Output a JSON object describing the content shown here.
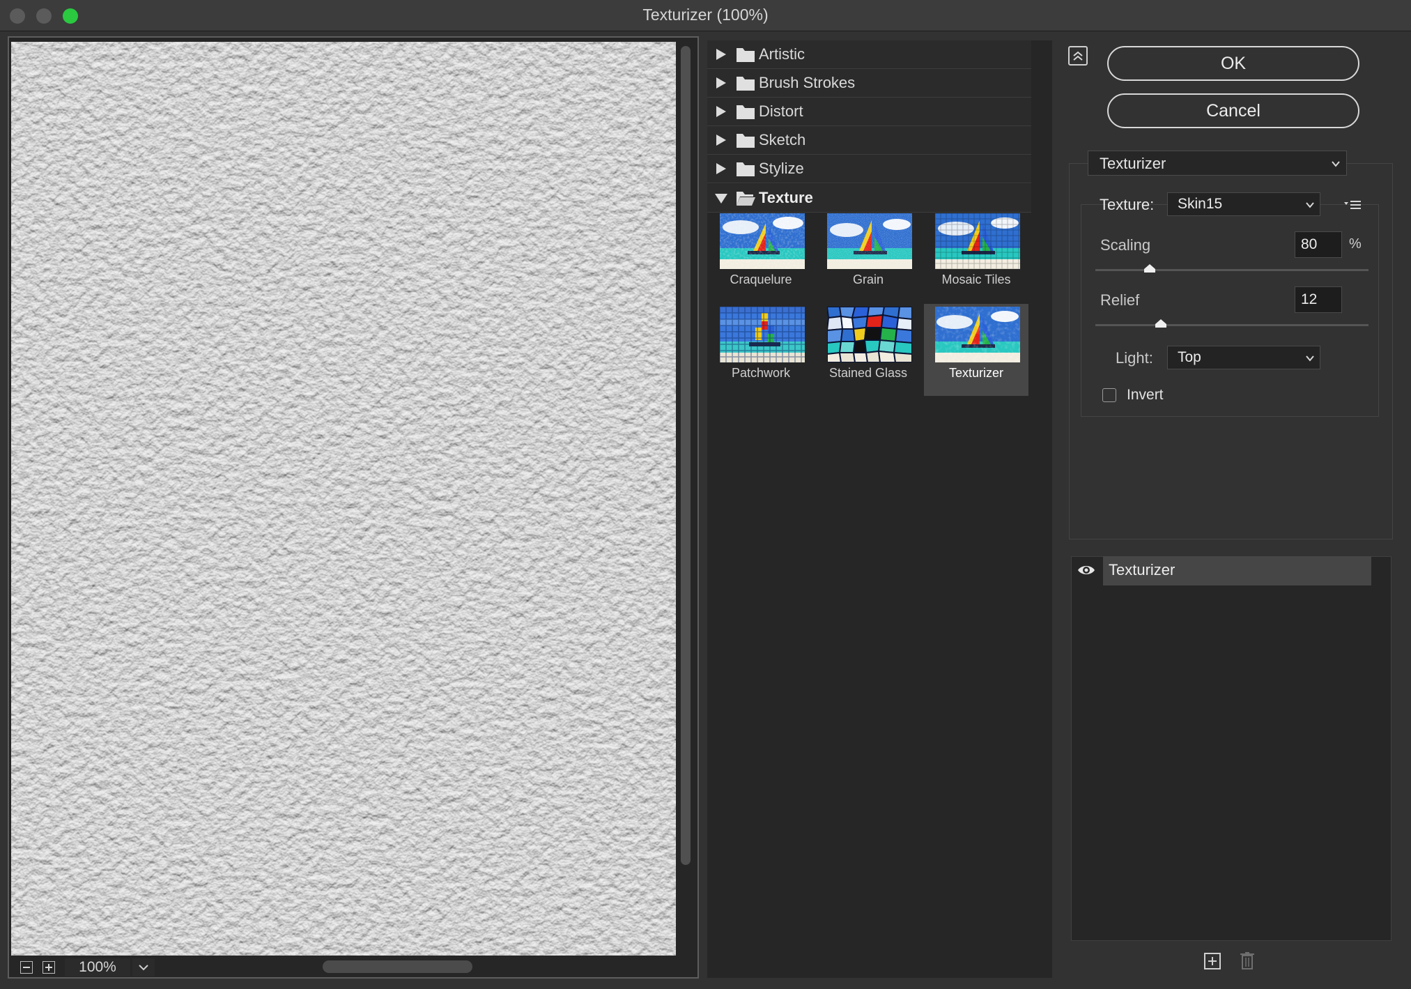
{
  "window": {
    "title": "Texturizer (100%)"
  },
  "preview": {
    "zoom": "100%",
    "zoom_out_icon": "minus-box-icon",
    "zoom_in_icon": "plus-box-icon"
  },
  "gallery": {
    "categories": [
      {
        "label": "Artistic",
        "expanded": false
      },
      {
        "label": "Brush Strokes",
        "expanded": false
      },
      {
        "label": "Distort",
        "expanded": false
      },
      {
        "label": "Sketch",
        "expanded": false
      },
      {
        "label": "Stylize",
        "expanded": false
      },
      {
        "label": "Texture",
        "expanded": true
      }
    ],
    "filters": [
      {
        "label": "Craquelure"
      },
      {
        "label": "Grain"
      },
      {
        "label": "Mosaic Tiles"
      },
      {
        "label": "Patchwork"
      },
      {
        "label": "Stained Glass"
      },
      {
        "label": "Texturizer",
        "selected": true
      }
    ]
  },
  "buttons": {
    "ok": "OK",
    "cancel": "Cancel"
  },
  "settings": {
    "filter_select": "Texturizer",
    "texture_label": "Texture:",
    "texture_value": "Skin15",
    "scaling_label": "Scaling",
    "scaling_value": "80",
    "scaling_unit": "%",
    "scaling_slider_fraction": 0.2,
    "relief_label": "Relief",
    "relief_value": "12",
    "relief_slider_fraction": 0.24,
    "light_label": "Light:",
    "light_value": "Top",
    "invert_label": "Invert",
    "invert_checked": false
  },
  "layers": {
    "items": [
      {
        "name": "Texturizer",
        "visible": true
      }
    ]
  },
  "colors": {
    "accent_green": "#2ac940",
    "panel_bg": "#323232",
    "dark_bg": "#262626",
    "selected_bg": "#474747"
  }
}
